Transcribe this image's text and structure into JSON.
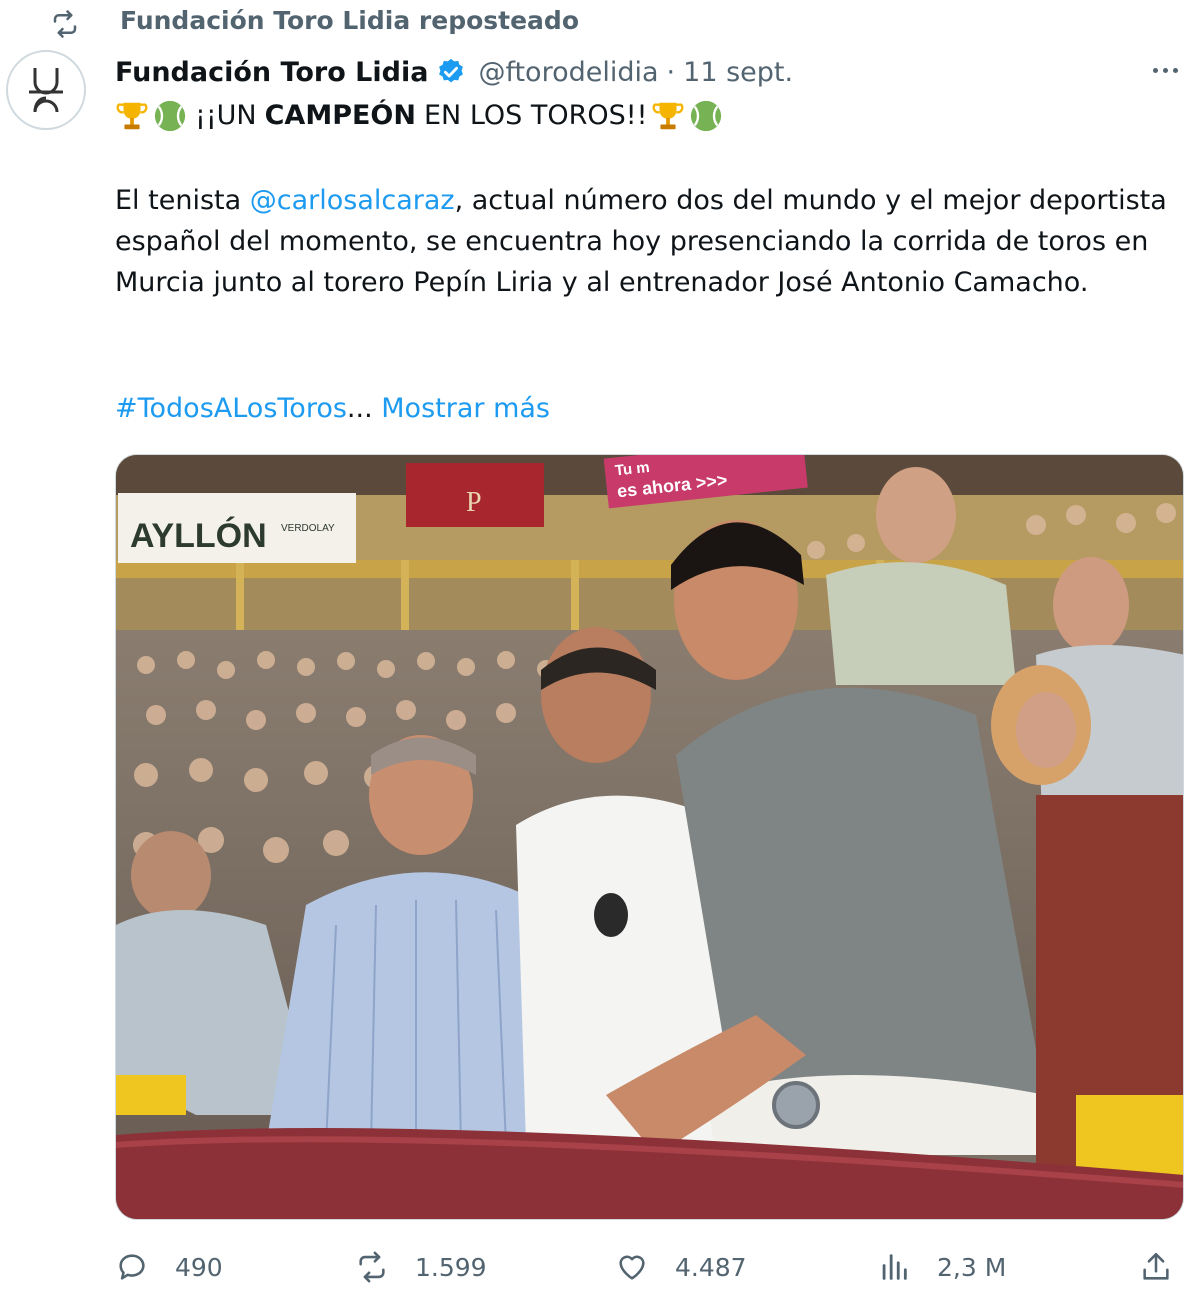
{
  "repost": {
    "label": "Fundación Toro Lidia reposteado"
  },
  "post": {
    "display_name": "Fundación Toro Lidia",
    "handle": "@ftorodelidia",
    "separator": "·",
    "date": "11 sept.",
    "headline": {
      "prefix": "¡¡UN",
      "bold": "CAMPEÓN",
      "suffix": "EN LOS TOROS!!"
    },
    "body_before_mention": "El tenista ",
    "mention": "@carlosalcaraz",
    "body_after_mention": ", actual número dos del mundo y el mejor deportista español del momento, se encuentra hoy presenciando la corrida de toros en Murcia junto al torero Pepín Liria y al entrenador José Antonio Camacho.",
    "hashtag": "#TodosALosToros",
    "ellipsis": "...",
    "show_more": "Mostrar más",
    "photo": {
      "banner_left": "AYLLÓN",
      "banner_left_small": "VERDOLAY",
      "banner_right": "es ahora >>>",
      "banner_right_top": "Tu m",
      "balcony_letter": "P"
    }
  },
  "actions": {
    "replies": "490",
    "reposts": "1.599",
    "likes": "4.487",
    "views": "2,3 M"
  },
  "icons": [
    "repost-icon",
    "verified-badge-icon",
    "more-icon",
    "trophy-icon",
    "tennis-ball-icon",
    "reply-icon",
    "like-icon",
    "views-icon",
    "share-icon"
  ],
  "colors": {
    "accent": "#1d9bf0",
    "muted": "#536471",
    "text": "#0f1419"
  }
}
